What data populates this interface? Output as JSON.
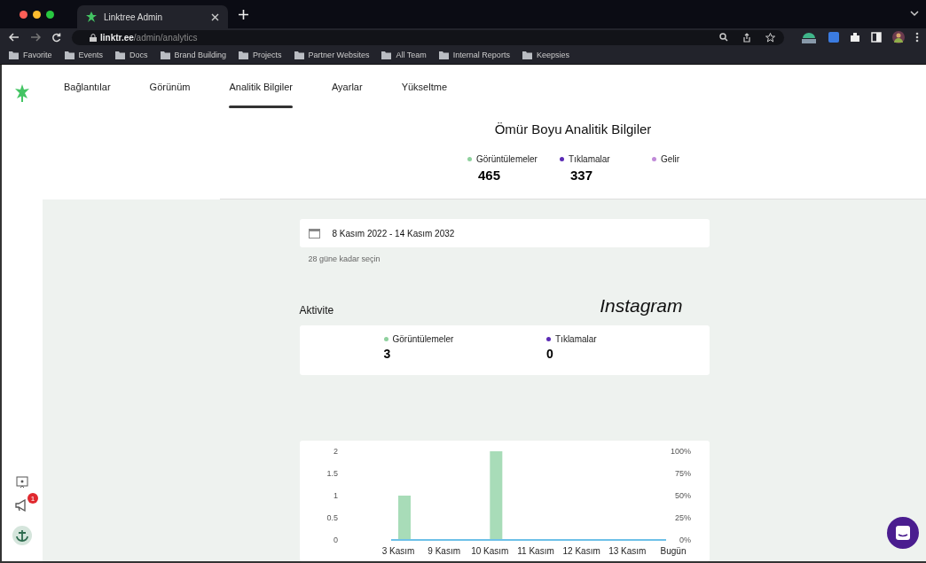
{
  "browser": {
    "tab_title": "Linktree Admin",
    "url_host": "linktr.ee",
    "url_path": "/admin/analytics",
    "bookmarks": [
      "Favorite",
      "Events",
      "Docs",
      "Brand Building",
      "Projects",
      "Partner Websites",
      "All Team",
      "Internal Reports",
      "Keepsies"
    ]
  },
  "nav": {
    "tabs": [
      {
        "label": "Bağlantılar",
        "selected": false
      },
      {
        "label": "Görünüm",
        "selected": false
      },
      {
        "label": "Analitik Bilgiler",
        "selected": true
      },
      {
        "label": "Ayarlar",
        "selected": false
      },
      {
        "label": "Yükseltme",
        "selected": false
      }
    ]
  },
  "lifetime": {
    "title": "Ömür Boyu Analitik Bilgiler",
    "stats": [
      {
        "label": "Görüntülemeler",
        "value": "465",
        "color": "#8fd19e"
      },
      {
        "label": "Tıklamalar",
        "value": "337",
        "color": "#5b2bb5"
      },
      {
        "label": "Gelir",
        "color": "#c08ad8"
      }
    ]
  },
  "date_range": {
    "value": "8 Kasım 2022 - 14 Kasım 2032",
    "hint": "28 güne kadar seçin"
  },
  "activity": {
    "title": "Aktivite",
    "overlay_text": "Instagram",
    "stats": [
      {
        "label": "Görüntülemeler",
        "value": "3",
        "color": "#8fd19e"
      },
      {
        "label": "Tıklamalar",
        "value": "0",
        "color": "#5b2bb5"
      }
    ],
    "chart_data": {
      "type": "bar",
      "categories": [
        "3 Kasım",
        "9 Kasım",
        "10 Kasım",
        "11 Kasım",
        "12 Kasım",
        "13 Kasım",
        "Bugün"
      ],
      "yticks": [
        0,
        0.5,
        1,
        1.5,
        2
      ],
      "ylim": [
        0,
        2
      ],
      "y2lim": [
        0,
        1
      ],
      "y2ticks": [
        {
          "value": 0,
          "label": "0%"
        },
        {
          "value": 0.25,
          "label": "25%"
        },
        {
          "value": 0.5,
          "label": "50%"
        },
        {
          "value": 0.75,
          "label": "75%"
        },
        {
          "value": 1,
          "label": "100%"
        }
      ],
      "series": [
        {
          "color": "#a8dcb8",
          "values": [
            1,
            0,
            2,
            0,
            0,
            0,
            0
          ]
        },
        {
          "color": "#6ec1e8",
          "values": [
            0,
            0,
            0,
            0,
            0,
            0,
            0
          ]
        }
      ]
    }
  },
  "sidebar": {
    "notification_count": "1"
  }
}
